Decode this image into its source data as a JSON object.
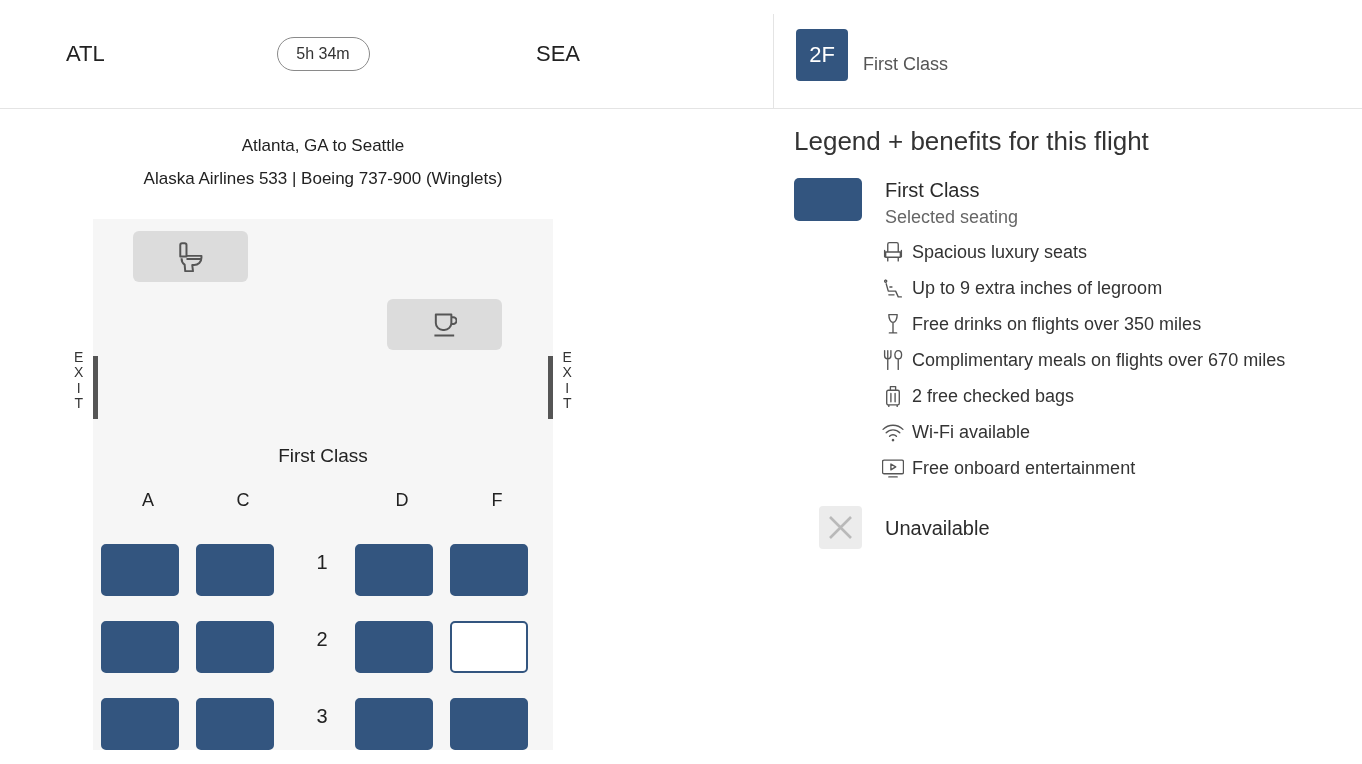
{
  "flight_header": {
    "origin": "ATL",
    "duration": "5h 34m",
    "destination": "SEA"
  },
  "selected_seat": {
    "seat": "2F",
    "cabin": "First Class"
  },
  "seat_map": {
    "route": "Atlanta, GA to Seattle",
    "flight": "Alaska Airlines 533 | Boeing 737-900 (Winglets)",
    "exits": [
      "EXIT",
      "EXIT"
    ],
    "cabin": "First Class",
    "columns": [
      "A",
      "C",
      "D",
      "F"
    ],
    "rows": [
      {
        "number": "1",
        "seats": [
          {
            "selected": false
          },
          {
            "selected": false
          },
          {
            "selected": false
          },
          {
            "selected": false
          }
        ]
      },
      {
        "number": "2",
        "seats": [
          {
            "selected": false
          },
          {
            "selected": false
          },
          {
            "selected": false
          },
          {
            "selected": true
          }
        ]
      },
      {
        "number": "3",
        "seats": [
          {
            "selected": false
          },
          {
            "selected": false
          },
          {
            "selected": false
          },
          {
            "selected": false
          }
        ]
      }
    ]
  },
  "legend": {
    "title": "Legend + benefits for this flight",
    "items": [
      {
        "kind": "cabin",
        "label": "First Class",
        "description": "Selected seating",
        "benefits": [
          {
            "kind": "seat",
            "text": "Spacious luxury seats"
          },
          {
            "kind": "legroom",
            "text": "Up to 9 extra inches of legroom"
          },
          {
            "kind": "drink",
            "text": "Free drinks on flights over 350 miles"
          },
          {
            "kind": "meal",
            "text": "Complimentary meals on flights over 670 miles"
          },
          {
            "kind": "bag",
            "text": "2 free checked bags"
          },
          {
            "kind": "wifi",
            "text": "Wi-Fi available"
          },
          {
            "kind": "entertainment",
            "text": "Free onboard entertainment"
          }
        ]
      },
      {
        "kind": "unavailable",
        "label": "Unavailable"
      }
    ]
  }
}
